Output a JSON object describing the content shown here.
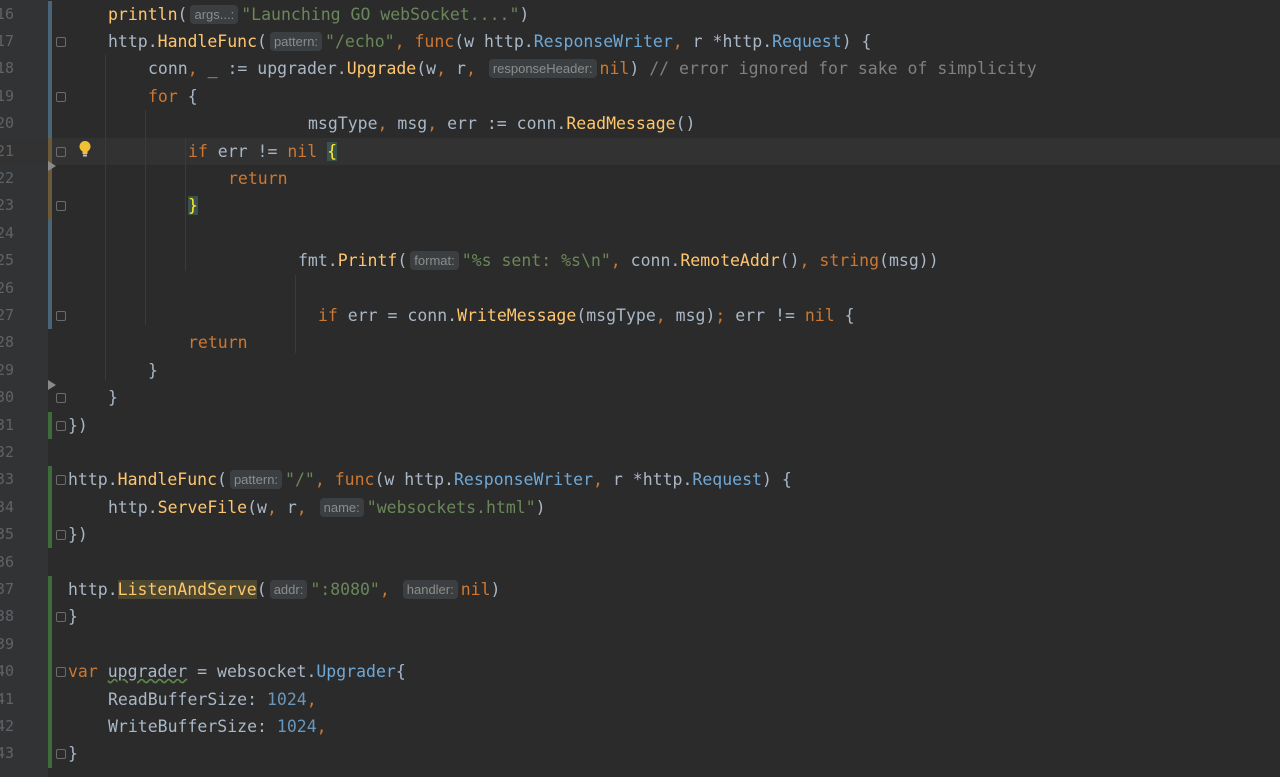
{
  "editor": {
    "language": "Go",
    "colors": {
      "background": "#2b2b2b",
      "keyword": "#cc7832",
      "string": "#6a8759",
      "number": "#6897bb",
      "function": "#ffc66d",
      "comment": "#808080"
    },
    "lines": [
      {
        "n": "16",
        "t": [
          [
            "fn",
            "println"
          ],
          [
            "",
            "("
          ],
          [
            "hint",
            "args...:"
          ],
          [
            "str",
            "\"Launching GO webSocket....\""
          ],
          [
            "",
            ")"
          ]
        ]
      },
      {
        "n": "17",
        "t": [
          [
            "",
            "http."
          ],
          [
            "fn",
            "HandleFunc"
          ],
          [
            "",
            "("
          ],
          [
            "hint",
            "pattern:"
          ],
          [
            "str",
            "\"/echo\""
          ],
          [
            "punc",
            ", "
          ],
          [
            "kw",
            "func"
          ],
          [
            "",
            "(w "
          ],
          [
            "",
            "http."
          ],
          [
            "typ",
            "ResponseWriter"
          ],
          [
            "punc",
            ", "
          ],
          [
            "",
            "r *http."
          ],
          [
            "typ",
            "Request"
          ],
          [
            "",
            ") {"
          ]
        ]
      },
      {
        "n": "18",
        "t": [
          [
            "",
            "conn"
          ],
          [
            "punc",
            ", "
          ],
          [
            "",
            "_ := upgrader."
          ],
          [
            "fn",
            "Upgrade"
          ],
          [
            "",
            "(w"
          ],
          [
            "punc",
            ", "
          ],
          [
            "",
            "r"
          ],
          [
            "punc",
            ", "
          ],
          [
            "hint",
            "responseHeader:"
          ],
          [
            "kw",
            "nil"
          ],
          [
            "",
            ") "
          ],
          [
            "cmt",
            "// error ignored for sake of simplicity"
          ]
        ]
      },
      {
        "n": "19",
        "t": [
          [
            "kw",
            "for"
          ],
          [
            "",
            " {"
          ]
        ]
      },
      {
        "n": "20",
        "t": [
          [
            "",
            "msgType"
          ],
          [
            "punc",
            ", "
          ],
          [
            "",
            "msg"
          ],
          [
            "punc",
            ", "
          ],
          [
            "",
            "err := conn."
          ],
          [
            "fn",
            "ReadMessage"
          ],
          [
            "",
            "()"
          ]
        ]
      },
      {
        "n": "21",
        "t": [
          [
            "kw",
            "if"
          ],
          [
            "",
            " err != "
          ],
          [
            "kw",
            "nil"
          ],
          [
            "",
            " "
          ],
          [
            "brace",
            "{"
          ]
        ]
      },
      {
        "n": "22",
        "t": [
          [
            "kw",
            "return"
          ]
        ]
      },
      {
        "n": "23",
        "t": [
          [
            "brace",
            "}"
          ]
        ]
      },
      {
        "n": "24",
        "t": []
      },
      {
        "n": "25",
        "t": [
          [
            "",
            "fmt."
          ],
          [
            "fn",
            "Printf"
          ],
          [
            "",
            "("
          ],
          [
            "hint",
            "format:"
          ],
          [
            "str",
            "\"%s sent: %s\\n\""
          ],
          [
            "punc",
            ", "
          ],
          [
            "",
            "conn."
          ],
          [
            "fn",
            "RemoteAddr"
          ],
          [
            "",
            "()"
          ],
          [
            "punc",
            ", "
          ],
          [
            "kw",
            "string"
          ],
          [
            "",
            "(msg))"
          ]
        ]
      },
      {
        "n": "26",
        "t": []
      },
      {
        "n": "27",
        "t": [
          [
            "kw",
            "if"
          ],
          [
            "",
            " err = conn."
          ],
          [
            "fn",
            "WriteMessage"
          ],
          [
            "",
            "(msgType"
          ],
          [
            "punc",
            ", "
          ],
          [
            "",
            "msg)"
          ],
          [
            "punc",
            "; "
          ],
          [
            "",
            "err != "
          ],
          [
            "kw",
            "nil"
          ],
          [
            "",
            " {"
          ]
        ]
      },
      {
        "n": "28",
        "t": [
          [
            "kw",
            "return"
          ]
        ]
      },
      {
        "n": "29",
        "t": [
          [
            "",
            "}"
          ]
        ]
      },
      {
        "n": "30",
        "t": [
          [
            "",
            "}"
          ]
        ]
      },
      {
        "n": "31",
        "t": [
          [
            "",
            "})"
          ]
        ]
      },
      {
        "n": "32",
        "t": []
      },
      {
        "n": "33",
        "t": [
          [
            "",
            "http."
          ],
          [
            "fn",
            "HandleFunc"
          ],
          [
            "",
            "("
          ],
          [
            "hint",
            "pattern:"
          ],
          [
            "str",
            "\"/\""
          ],
          [
            "punc",
            ", "
          ],
          [
            "kw",
            "func"
          ],
          [
            "",
            "(w "
          ],
          [
            "",
            "http."
          ],
          [
            "typ",
            "ResponseWriter"
          ],
          [
            "punc",
            ", "
          ],
          [
            "",
            "r *http."
          ],
          [
            "typ",
            "Request"
          ],
          [
            "",
            ") {"
          ]
        ]
      },
      {
        "n": "34",
        "t": [
          [
            "",
            "http."
          ],
          [
            "fn",
            "ServeFile"
          ],
          [
            "",
            "(w"
          ],
          [
            "punc",
            ", "
          ],
          [
            "",
            "r"
          ],
          [
            "punc",
            ", "
          ],
          [
            "hint",
            "name:"
          ],
          [
            "str",
            "\"websockets.html\""
          ],
          [
            "",
            ")"
          ]
        ]
      },
      {
        "n": "35",
        "t": [
          [
            "",
            "})"
          ]
        ]
      },
      {
        "n": "36",
        "t": []
      },
      {
        "n": "37",
        "t": [
          [
            "",
            "http."
          ],
          [
            "hlfn",
            "ListenAndServe"
          ],
          [
            "",
            "("
          ],
          [
            "hint",
            "addr:"
          ],
          [
            "str",
            "\":8080\""
          ],
          [
            "punc",
            ", "
          ],
          [
            "hint",
            "handler:"
          ],
          [
            "kw",
            "nil"
          ],
          [
            "",
            ")"
          ]
        ]
      },
      {
        "n": "38",
        "t": [
          [
            "",
            "}"
          ]
        ]
      },
      {
        "n": "39",
        "t": []
      },
      {
        "n": "40",
        "t": [
          [
            "kw",
            "var"
          ],
          [
            "",
            " "
          ],
          [
            "squig",
            "upgrader"
          ],
          [
            "",
            " = websocket."
          ],
          [
            "typ",
            "Upgrader"
          ],
          [
            "",
            "{"
          ]
        ]
      },
      {
        "n": "41",
        "t": [
          [
            "",
            "ReadBufferSize: "
          ],
          [
            "num",
            "1024"
          ],
          [
            "punc",
            ","
          ]
        ]
      },
      {
        "n": "42",
        "t": [
          [
            "",
            "WriteBufferSize: "
          ],
          [
            "num",
            "1024"
          ],
          [
            "punc",
            ","
          ]
        ]
      },
      {
        "n": "43",
        "t": [
          [
            "",
            "}"
          ]
        ]
      }
    ]
  }
}
